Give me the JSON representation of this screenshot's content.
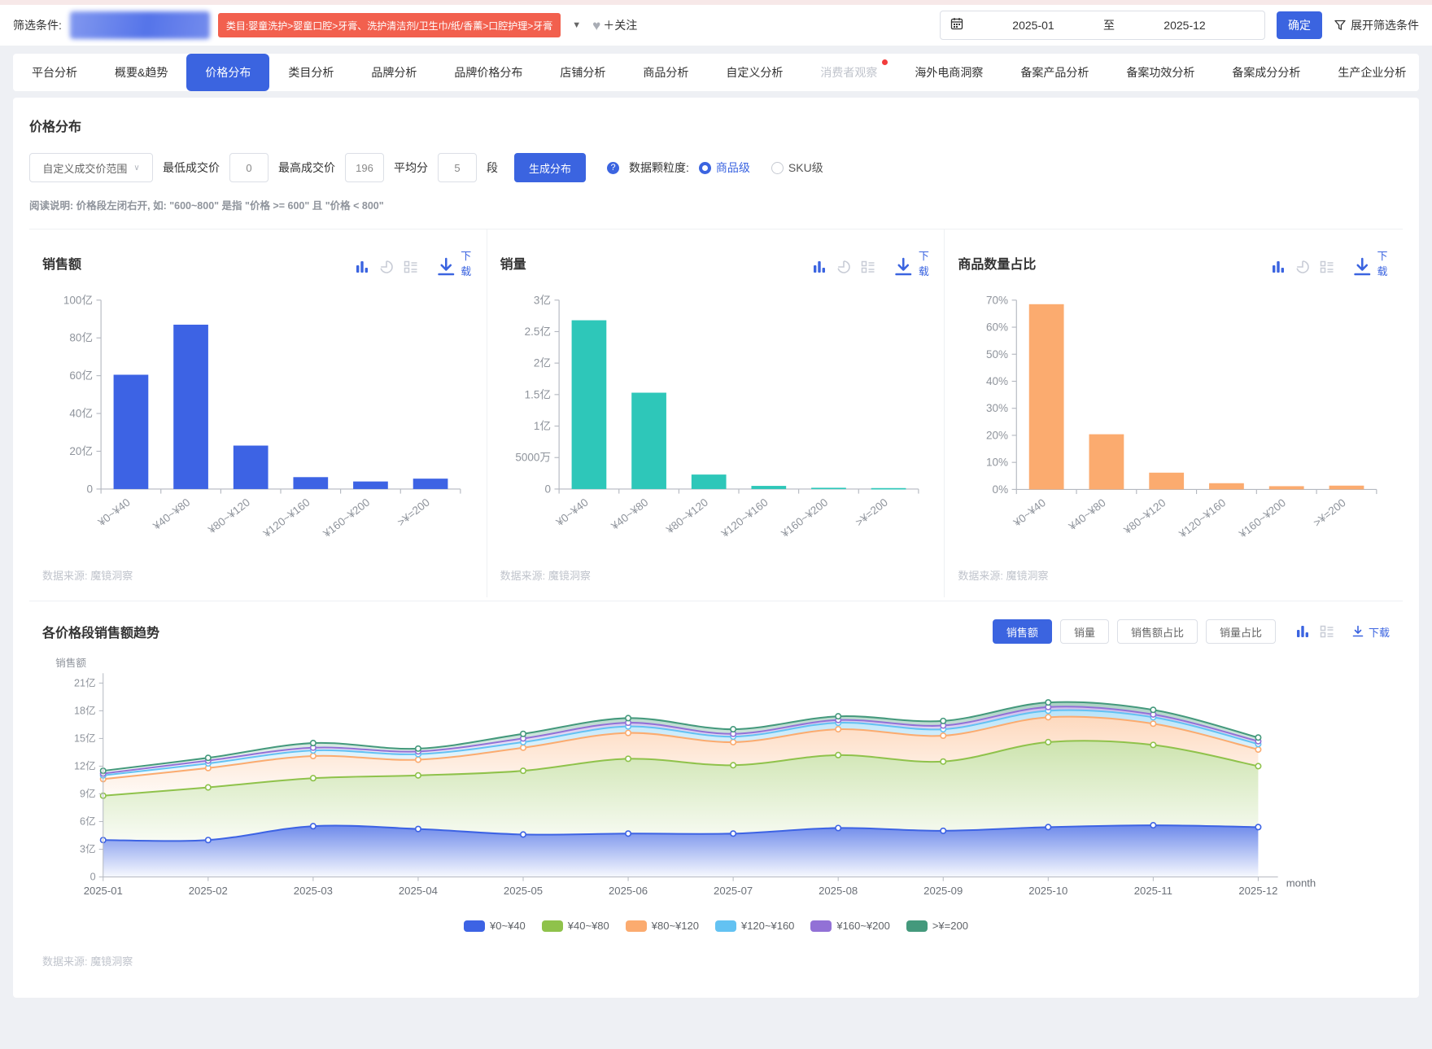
{
  "topbar": {
    "filter_label": "筛选条件:",
    "category_tag": "类目:婴童洗护>婴童口腔>牙膏、洗护清洁剂/卫生巾/纸/香薰>口腔护理>牙膏",
    "follow_label": "＋关注",
    "date_start": "2025-01",
    "date_sep": "至",
    "date_end": "2025-12",
    "confirm_label": "确定",
    "expand_label": "展开筛选条件"
  },
  "tabs": {
    "items": [
      "平台分析",
      "概要&趋势",
      "价格分布",
      "类目分析",
      "品牌分析",
      "品牌价格分布",
      "店铺分析",
      "商品分析",
      "自定义分析",
      "消费者观察",
      "海外电商洞察",
      "备案产品分析",
      "备案功效分析",
      "备案成分分析",
      "生产企业分析"
    ],
    "active_index": 2,
    "disabled_index": 9
  },
  "price_section": {
    "title": "价格分布",
    "range_select": "自定义成交价范围",
    "min_label": "最低成交价",
    "min_value": "0",
    "max_label": "最高成交价",
    "max_value": "196",
    "avg_label": "平均分",
    "avg_value": "5",
    "seg_label": "段",
    "generate_label": "生成分布",
    "granularity_label": "数据颗粒度:",
    "granularity_options": [
      "商品级",
      "SKU级"
    ],
    "granularity_selected": 0,
    "note": "阅读说明: 价格段左闭右开, 如: \"600~800\" 是指 \"价格 >= 600\" 且 \"价格 < 800\""
  },
  "download_label": "下载",
  "datasource": "数据来源: 魔镜洞察",
  "trend": {
    "title": "各价格段销售额趋势",
    "buttons": [
      "销售额",
      "销量",
      "销售额占比",
      "销量占比"
    ],
    "active_index": 0
  },
  "colors": {
    "accent": "#3b64e0",
    "icon_inactive": "#c8ccd6",
    "tag_red": "#f2604e"
  },
  "chart_data": [
    {
      "type": "bar",
      "title": "销售额",
      "categories": [
        "¥0~¥40",
        "¥40~¥80",
        "¥80~¥120",
        "¥120~¥160",
        "¥160~¥200",
        ">¥=200"
      ],
      "values": [
        60.5,
        87,
        23,
        6.3,
        4,
        5.5
      ],
      "ylim": [
        0,
        100
      ],
      "yticks": [
        {
          "v": 0,
          "label": "0"
        },
        {
          "v": 20,
          "label": "20亿"
        },
        {
          "v": 40,
          "label": "40亿"
        },
        {
          "v": 60,
          "label": "60亿"
        },
        {
          "v": 80,
          "label": "80亿"
        },
        {
          "v": 100,
          "label": "100亿"
        }
      ],
      "color": "#3d63e4"
    },
    {
      "type": "bar",
      "title": "销量",
      "categories": [
        "¥0~¥40",
        "¥40~¥80",
        "¥80~¥120",
        "¥120~¥160",
        "¥160~¥200",
        ">¥=200"
      ],
      "values": [
        2.68,
        1.53,
        0.23,
        0.05,
        0.02,
        0.015
      ],
      "ylim": [
        0,
        3
      ],
      "yticks": [
        {
          "v": 0,
          "label": "0"
        },
        {
          "v": 0.5,
          "label": "5000万"
        },
        {
          "v": 1,
          "label": "1亿"
        },
        {
          "v": 1.5,
          "label": "1.5亿"
        },
        {
          "v": 2,
          "label": "2亿"
        },
        {
          "v": 2.5,
          "label": "2.5亿"
        },
        {
          "v": 3,
          "label": "3亿"
        }
      ],
      "color": "#2ec7b9"
    },
    {
      "type": "bar",
      "title": "商品数量占比",
      "categories": [
        "¥0~¥40",
        "¥40~¥80",
        "¥80~¥120",
        "¥120~¥160",
        "¥160~¥200",
        ">¥=200"
      ],
      "values": [
        68.5,
        20.4,
        6.2,
        2.3,
        1.2,
        1.4
      ],
      "ylim": [
        0,
        70
      ],
      "yticks": [
        {
          "v": 0,
          "label": "0%"
        },
        {
          "v": 10,
          "label": "10%"
        },
        {
          "v": 20,
          "label": "20%"
        },
        {
          "v": 30,
          "label": "30%"
        },
        {
          "v": 40,
          "label": "40%"
        },
        {
          "v": 50,
          "label": "50%"
        },
        {
          "v": 60,
          "label": "60%"
        },
        {
          "v": 70,
          "label": "70%"
        }
      ],
      "color": "#fbab6f"
    },
    {
      "type": "area-stacked",
      "title": "各价格段销售额趋势",
      "ylabel": "销售额",
      "xlabel": "month",
      "x": [
        "2025-01",
        "2025-02",
        "2025-03",
        "2025-04",
        "2025-05",
        "2025-06",
        "2025-07",
        "2025-08",
        "2025-09",
        "2025-10",
        "2025-11",
        "2025-12"
      ],
      "ylim": [
        0,
        21
      ],
      "yticks": [
        {
          "v": 0,
          "label": "0"
        },
        {
          "v": 3,
          "label": "3亿"
        },
        {
          "v": 6,
          "label": "6亿"
        },
        {
          "v": 9,
          "label": "9亿"
        },
        {
          "v": 12,
          "label": "12亿"
        },
        {
          "v": 15,
          "label": "15亿"
        },
        {
          "v": 18,
          "label": "18亿"
        },
        {
          "v": 21,
          "label": "21亿"
        }
      ],
      "series": [
        {
          "name": "¥0~¥40",
          "color": "#3d63e4",
          "values": [
            4.0,
            4.0,
            5.5,
            5.2,
            4.6,
            4.7,
            4.7,
            5.3,
            5.0,
            5.4,
            5.6,
            5.4
          ]
        },
        {
          "name": "¥40~¥80",
          "color": "#8fc24b",
          "values": [
            4.8,
            5.7,
            5.2,
            5.8,
            6.9,
            8.1,
            7.4,
            7.9,
            7.5,
            9.2,
            8.7,
            6.6
          ]
        },
        {
          "name": "¥80~¥120",
          "color": "#fbab6f",
          "values": [
            1.8,
            2.1,
            2.4,
            1.7,
            2.5,
            2.8,
            2.5,
            2.8,
            2.8,
            2.7,
            2.3,
            1.8
          ]
        },
        {
          "name": "¥120~¥160",
          "color": "#63c2f2",
          "values": [
            0.4,
            0.5,
            0.6,
            0.6,
            0.6,
            0.7,
            0.6,
            0.7,
            0.7,
            0.7,
            0.7,
            0.6
          ]
        },
        {
          "name": "¥160~¥200",
          "color": "#9271d6",
          "values": [
            0.2,
            0.3,
            0.3,
            0.3,
            0.4,
            0.4,
            0.3,
            0.3,
            0.4,
            0.4,
            0.3,
            0.3
          ]
        },
        {
          "name": ">¥=200",
          "color": "#44997c",
          "values": [
            0.3,
            0.3,
            0.5,
            0.3,
            0.5,
            0.5,
            0.5,
            0.4,
            0.5,
            0.5,
            0.5,
            0.4
          ]
        }
      ],
      "legend_position": "bottom"
    }
  ]
}
